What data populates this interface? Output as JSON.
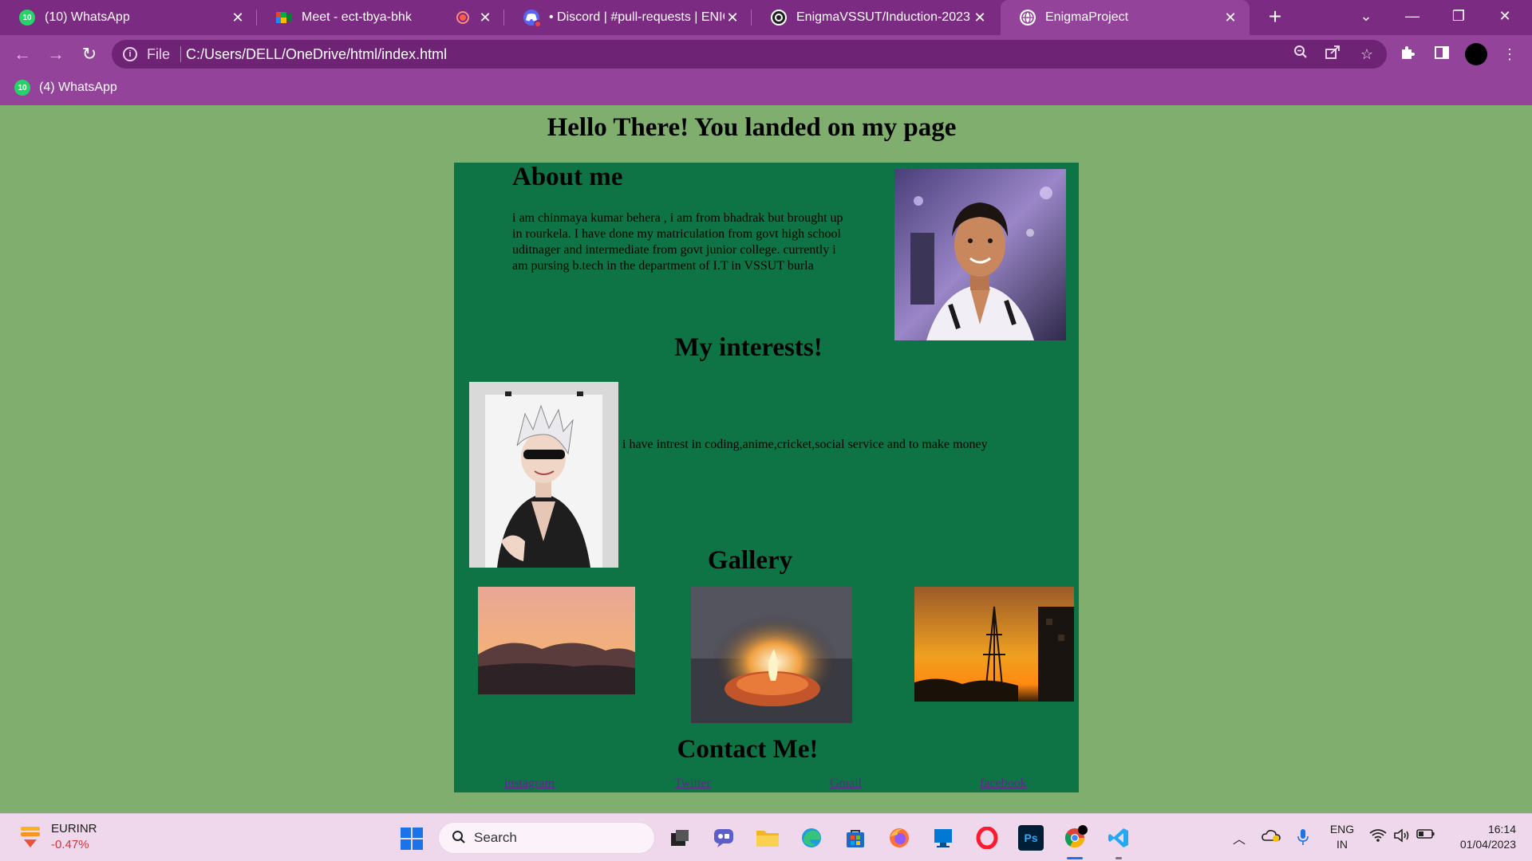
{
  "browser": {
    "tabs": [
      {
        "title": "(10) WhatsApp",
        "badge": "10",
        "icon": "whatsapp-icon",
        "active": false
      },
      {
        "title": "Meet - ect-tbya-bhk",
        "icon": "google-meet-icon",
        "active": false,
        "recording": true
      },
      {
        "title": "• Discord | #pull-requests | ENIGMA",
        "icon": "discord-icon",
        "active": false
      },
      {
        "title": "EnigmaVSSUT/Induction-2023",
        "icon": "github-icon",
        "active": false
      },
      {
        "title": "EnigmaProject",
        "icon": "globe-icon",
        "active": true
      }
    ],
    "address_scheme": "File",
    "address_url": "C:/Users/DELL/OneDrive/html/index.html",
    "bookmarks": [
      {
        "label": "(4) WhatsApp",
        "badge": "10",
        "icon": "whatsapp-icon"
      }
    ]
  },
  "page": {
    "heading": "Hello There! You landed on my page",
    "about": {
      "title": "About me",
      "text": "i am chinmaya kumar behera , i am from bhadrak but brought up in rourkela. I have done my matriculation from govt high school uditnager and intermediate from govt junior college. currently i am pursing b.tech in the department of I.T in VSSUT burla"
    },
    "interests": {
      "title": "My interests!",
      "text": "i have intrest in coding,anime,cricket,social service and to make money"
    },
    "gallery": {
      "title": "Gallery"
    },
    "contact": {
      "title": "Contact Me!",
      "links": [
        "instagram",
        "Twitter",
        "Gmail",
        "facebook"
      ]
    }
  },
  "taskbar": {
    "ticker_symbol": "EURINR",
    "ticker_change": "-0.47%",
    "search_placeholder": "Search",
    "language": "ENG",
    "region": "IN",
    "time": "16:14",
    "date": "01/04/2023"
  },
  "colors": {
    "browser_frame": "#7b2b82",
    "toolbar": "#93439a",
    "page_background": "#7fae6e",
    "card_background": "#0e7446",
    "link": "#5b2a86"
  }
}
